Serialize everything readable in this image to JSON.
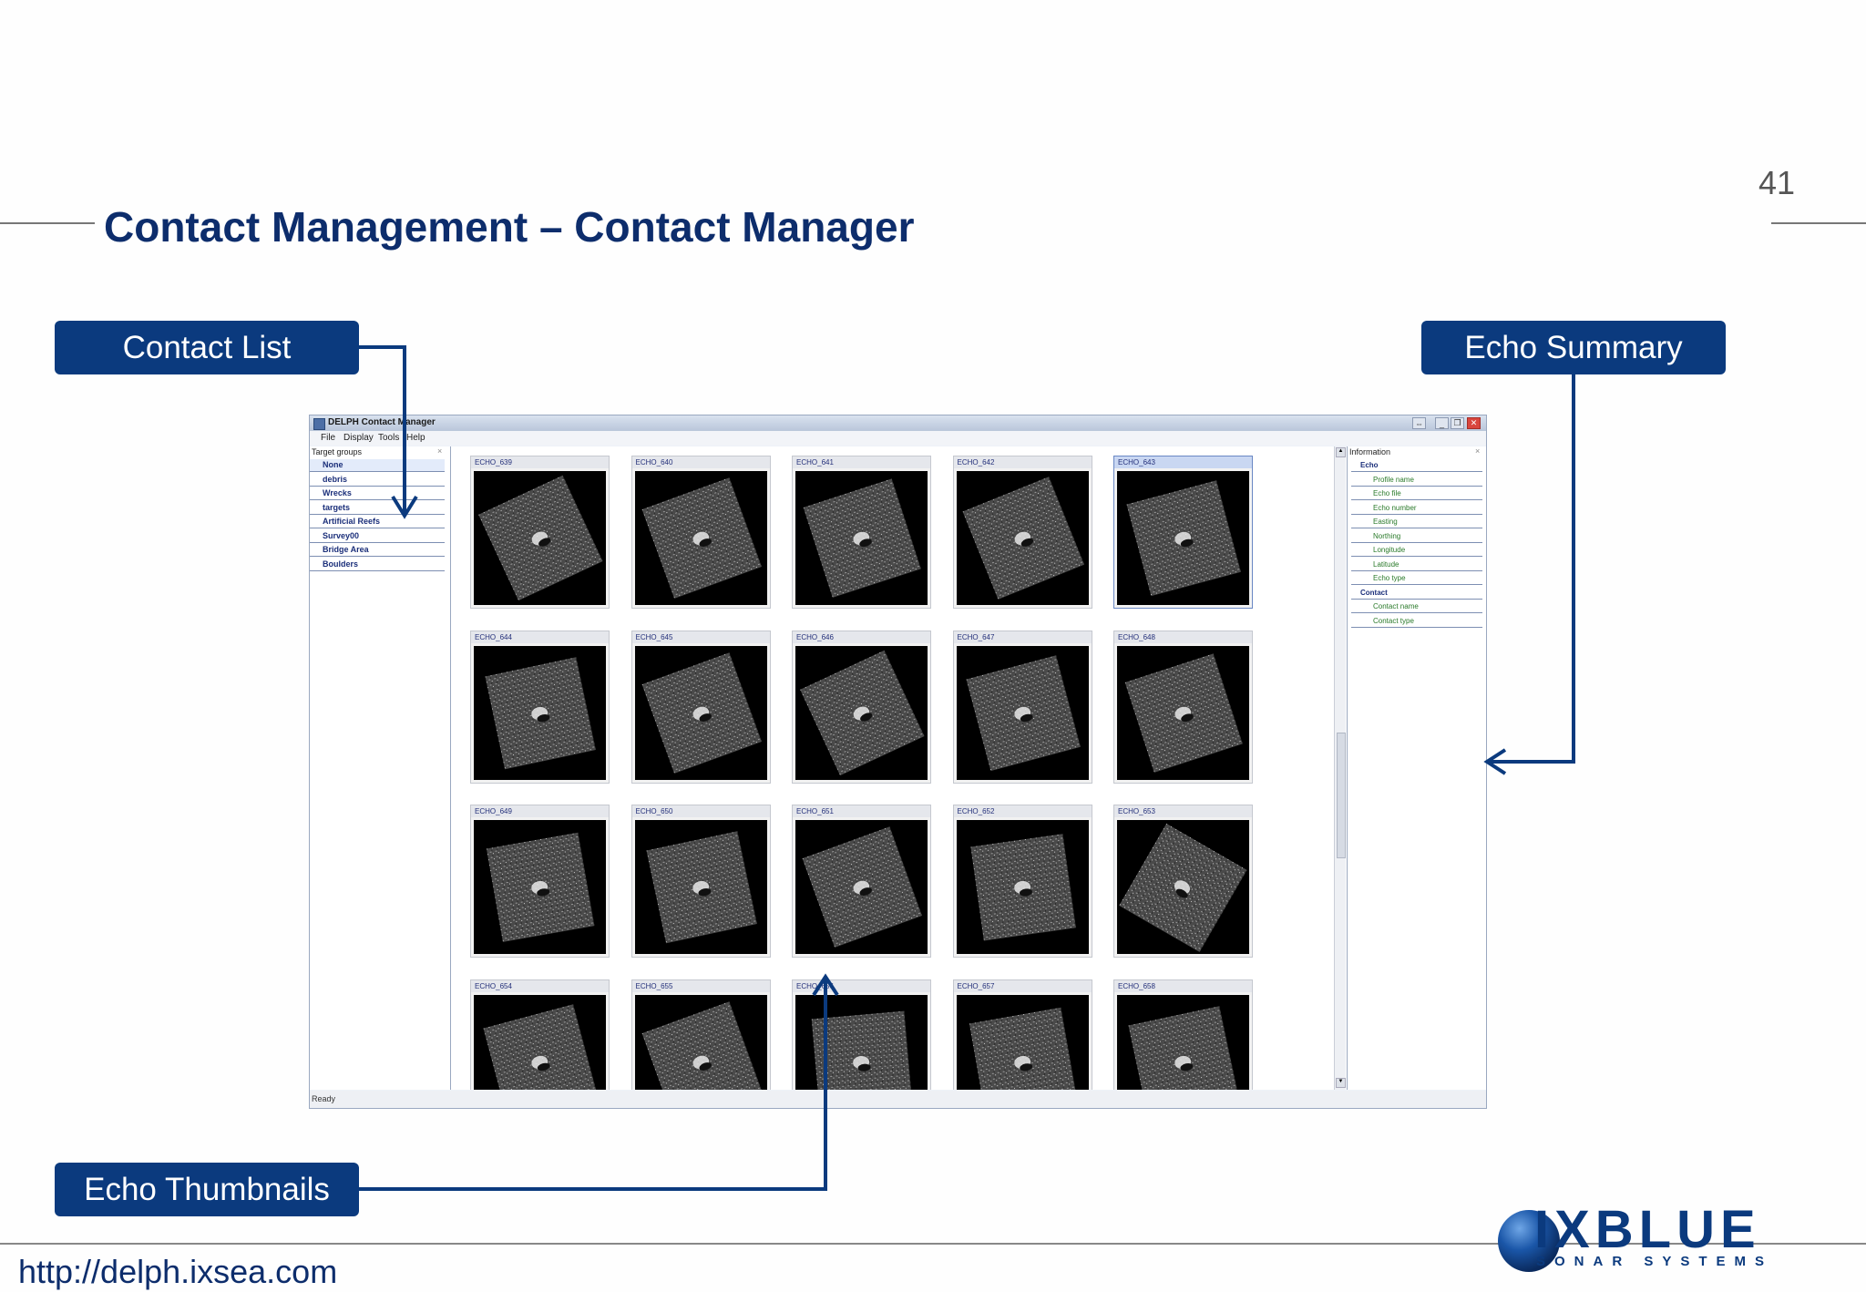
{
  "slide": {
    "page_number": "41",
    "title": "Contact Management – Contact Manager",
    "footer_url": "http://delph.ixsea.com"
  },
  "callouts": {
    "contact_list": "Contact List",
    "echo_summary": "Echo Summary",
    "echo_thumbnails": "Echo Thumbnails"
  },
  "logo": {
    "brand": "IXBLUE",
    "tagline": "SONAR SYSTEMS",
    "color": "#0b3a7e"
  },
  "window": {
    "title": "DELPH Contact Manager",
    "menu": [
      "File",
      "Display",
      "Tools",
      "Help"
    ],
    "status": "Ready",
    "left_panel": {
      "title": "Target groups",
      "groups": [
        "None",
        "debris",
        "Wrecks",
        "targets",
        "Artificial Reefs",
        "Survey00",
        "Bridge Area",
        "Boulders"
      ],
      "selected": "None"
    },
    "right_panel": {
      "title": "Information",
      "items": [
        {
          "label": "Echo",
          "category": true
        },
        {
          "label": "Profile name",
          "category": false
        },
        {
          "label": "Echo file",
          "category": false
        },
        {
          "label": "Echo number",
          "category": false
        },
        {
          "label": "Easting",
          "category": false
        },
        {
          "label": "Northing",
          "category": false
        },
        {
          "label": "Longitude",
          "category": false
        },
        {
          "label": "Latitude",
          "category": false
        },
        {
          "label": "Echo type",
          "category": false
        },
        {
          "label": "Contact",
          "category": true
        },
        {
          "label": "Contact name",
          "category": false
        },
        {
          "label": "Contact type",
          "category": false
        }
      ]
    },
    "thumbnails": [
      "ECHO_639",
      "ECHO_640",
      "ECHO_641",
      "ECHO_642",
      "ECHO_643",
      "ECHO_644",
      "ECHO_645",
      "ECHO_646",
      "ECHO_647",
      "ECHO_648",
      "ECHO_649",
      "ECHO_650",
      "ECHO_651",
      "ECHO_652",
      "ECHO_653",
      "ECHO_654",
      "ECHO_655",
      "ECHO_656",
      "ECHO_657",
      "ECHO_658"
    ],
    "selected_thumbnail": "ECHO_643"
  }
}
